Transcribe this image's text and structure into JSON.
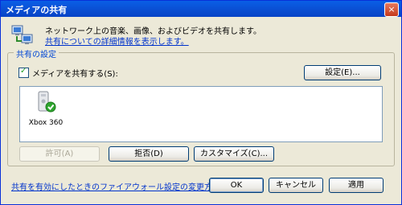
{
  "window": {
    "title": "メディアの共有",
    "close_label": "×"
  },
  "header": {
    "description": "ネットワーク上の音楽、画像、およびビデオを共有します。",
    "link": "共有についての詳細情報を表示します。",
    "icon": "network-computers-icon"
  },
  "sharing_group": {
    "label": "共有の設定",
    "checkbox_label": "メディアを共有する(S):",
    "checkbox_checked": true,
    "settings_button": "設定(E)..."
  },
  "devices": [
    {
      "label": "Xbox 360",
      "icon": "xbox-console-icon",
      "status": "allowed-check"
    }
  ],
  "device_buttons": {
    "allow": "許可(A)",
    "deny": "拒否(D)",
    "customize": "カスタマイズ(C)..."
  },
  "footer": {
    "firewall_link": "共有を有効にしたときのファイアウォール設定の変更方法",
    "ok": "OK",
    "cancel": "キャンセル",
    "apply": "適用"
  }
}
